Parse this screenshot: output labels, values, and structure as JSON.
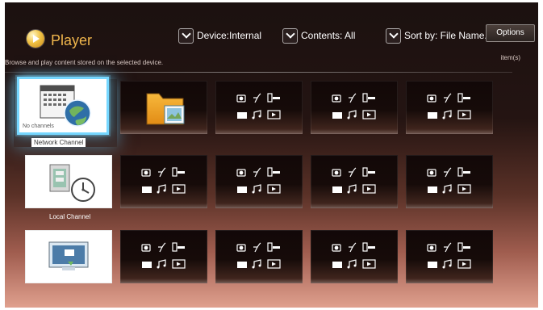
{
  "header": {
    "app_title": "Player",
    "device_label": "Device:Internal",
    "contents_label": "Contents: All",
    "sort_label": "Sort by: File Name...",
    "options_label": "Options",
    "description": "Browse and play content stored on the selected device.",
    "item_count": "item(s)"
  },
  "tiles": {
    "network_channel": {
      "label": "Network Channel",
      "status": "No channels"
    },
    "local_channel": {
      "label": "Local Channel"
    }
  },
  "icons": {
    "app_logo": "player-icon",
    "dropdown": "chevron-down-icon",
    "network": "network-globe-icon",
    "folder": "folder-icon",
    "local": "clock-icon",
    "media": "media-type-icon",
    "display": "display-icon"
  }
}
